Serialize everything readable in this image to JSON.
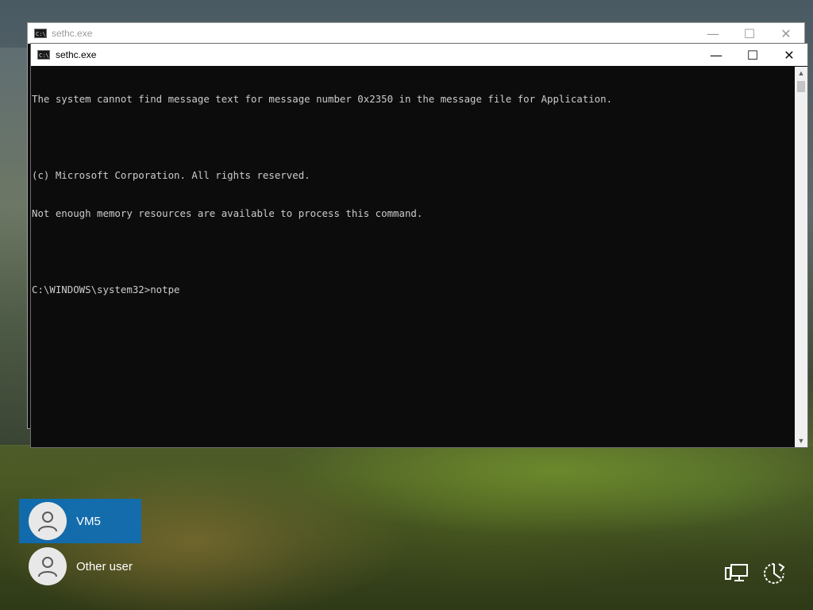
{
  "background_window": {
    "title": "sethc.exe",
    "controls": {
      "minimize": "—",
      "maximize": "☐",
      "close": "✕"
    }
  },
  "console_window": {
    "title": "sethc.exe",
    "icon": "cmd-icon",
    "icon_text": "C:\\",
    "controls": {
      "minimize": "—",
      "maximize": "☐",
      "close": "✕"
    },
    "lines": [
      "The system cannot find message text for message number 0x2350 in the message file for Application.",
      "",
      "(c) Microsoft Corporation. All rights reserved.",
      "Not enough memory resources are available to process this command.",
      "",
      "C:\\WINDOWS\\system32>notpe"
    ],
    "colors": {
      "background": "#0c0c0c",
      "text": "#cccccc"
    }
  },
  "users": [
    {
      "name": "VM5",
      "selected": true
    },
    {
      "name": "Other user",
      "selected": false
    }
  ],
  "system_icons": [
    "network-icon",
    "ease-of-access-icon"
  ],
  "colors": {
    "selected_user": "#0a6ebe"
  }
}
